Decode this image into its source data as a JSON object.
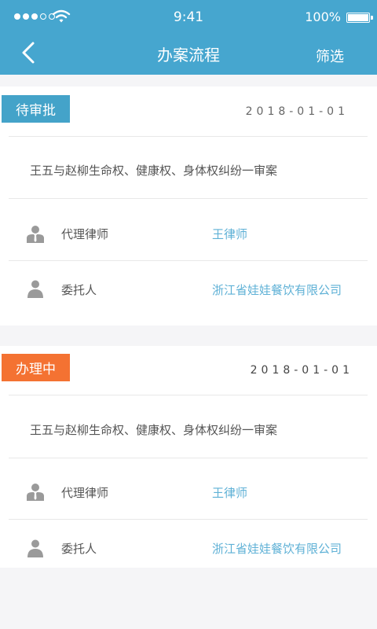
{
  "status_bar": {
    "time": "9:41",
    "battery": "100%"
  },
  "header": {
    "title": "办案流程",
    "filter_label": "筛选"
  },
  "cases": [
    {
      "status": "待审批",
      "status_color": "#44a3c9",
      "date": "2018-01-01",
      "case_name": "王五与赵柳生命权、健康权、身体权纠纷一审案",
      "lawyer_label": "代理律师",
      "lawyer_value": "王律师",
      "client_label": "委托人",
      "client_value": "浙江省娃娃餐饮有限公司"
    },
    {
      "status": "办理中",
      "status_color": "#f47232",
      "date": "2018-01-01",
      "case_name": "王五与赵柳生命权、健康权、身体权纠纷一审案",
      "lawyer_label": "代理律师",
      "lawyer_value": "王律师",
      "client_label": "委托人",
      "client_value": "浙江省娃娃餐饮有限公司"
    }
  ]
}
